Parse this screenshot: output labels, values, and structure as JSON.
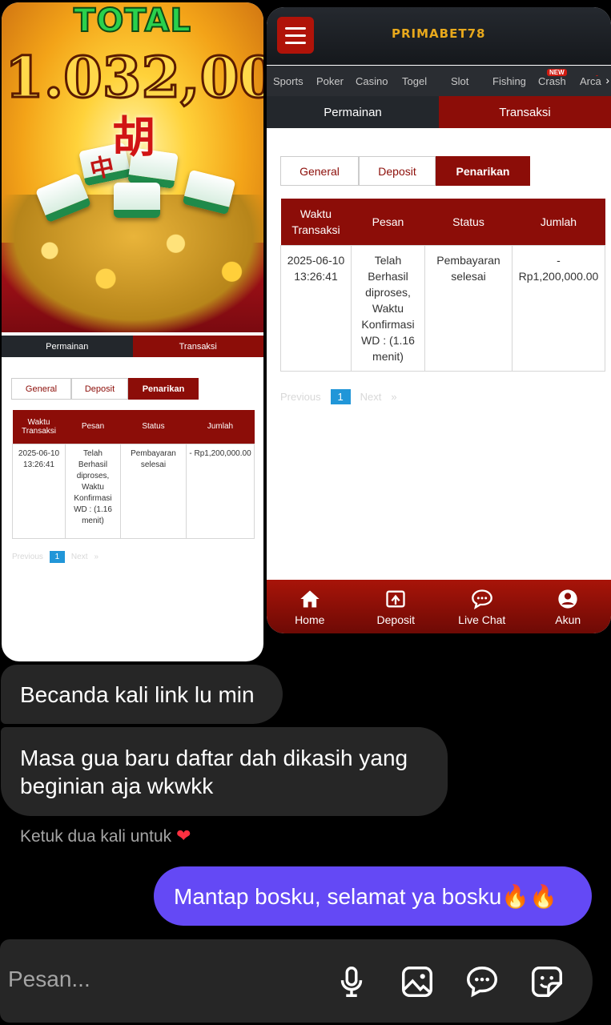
{
  "promo_image": {
    "total_label": "TOTAL",
    "amount": "1.032,00"
  },
  "left_screenshot": {
    "main_tabs": [
      "Permainan",
      "Transaksi"
    ],
    "sub_tabs": [
      "General",
      "Deposit",
      "Penarikan"
    ],
    "table": {
      "headers": [
        "Waktu Transaksi",
        "Pesan",
        "Status",
        "Jumlah"
      ],
      "row": {
        "waktu": "2025-06-10 13:26:41",
        "pesan": "Telah Berhasil diproses, Waktu Konfirmasi WD : (1.16 menit)",
        "status": "Pembayaran selesai",
        "jumlah": "- Rp1,200,000.00"
      }
    },
    "pagination": {
      "previous": "Previous",
      "current": "1",
      "next": "Next",
      "next_arrow": "»"
    }
  },
  "right_screenshot": {
    "brand": "PRIMABET78",
    "game_nav": [
      {
        "label": "Sports"
      },
      {
        "label": "Poker"
      },
      {
        "label": "Casino"
      },
      {
        "label": "Togel"
      },
      {
        "label": "Slot"
      },
      {
        "label": "Fishing"
      },
      {
        "label": "Crash",
        "badge": "NEW"
      },
      {
        "label": "Arca",
        "badge": "!"
      }
    ],
    "main_tabs": [
      "Permainan",
      "Transaksi"
    ],
    "sub_tabs": [
      "General",
      "Deposit",
      "Penarikan"
    ],
    "table": {
      "headers": [
        "Waktu Transaksi",
        "Pesan",
        "Status",
        "Jumlah"
      ],
      "row": {
        "waktu": "2025-06-10 13:26:41",
        "pesan": "Telah Berhasil diproses, Waktu Konfirmasi WD : (1.16 menit)",
        "status": "Pembayaran selesai",
        "jumlah": "- Rp1,200,000.00"
      }
    },
    "pagination": {
      "previous": "Previous",
      "current": "1",
      "next": "Next",
      "next_arrow": "»"
    },
    "bottom_nav": [
      {
        "label": "Home",
        "icon": "home-icon"
      },
      {
        "label": "Deposit",
        "icon": "deposit-icon"
      },
      {
        "label": "Live Chat",
        "icon": "chat-icon"
      },
      {
        "label": "Akun",
        "icon": "account-icon"
      }
    ]
  },
  "chat": {
    "messages": [
      {
        "from": "them",
        "text": "Becanda kali link lu min"
      },
      {
        "from": "them",
        "text": "Masa gua baru daftar dah dikasih yang beginian aja wkwkk"
      },
      {
        "from": "me",
        "text": "Mantap bosku, selamat ya bosku🔥🔥"
      }
    ],
    "tap_hint": "Ketuk dua kali untuk",
    "tap_hint_icon": "heart-icon",
    "composer_placeholder": "Pesan...",
    "composer_icons": [
      "microphone-icon",
      "gallery-icon",
      "message-icon",
      "sticker-icon"
    ]
  },
  "colors": {
    "brand_red": "#8c0d08",
    "brand_gold": "#e8a91c",
    "sent_bubble": "#6449f5",
    "received_bubble": "#262626",
    "page_link": "#2196d8"
  }
}
